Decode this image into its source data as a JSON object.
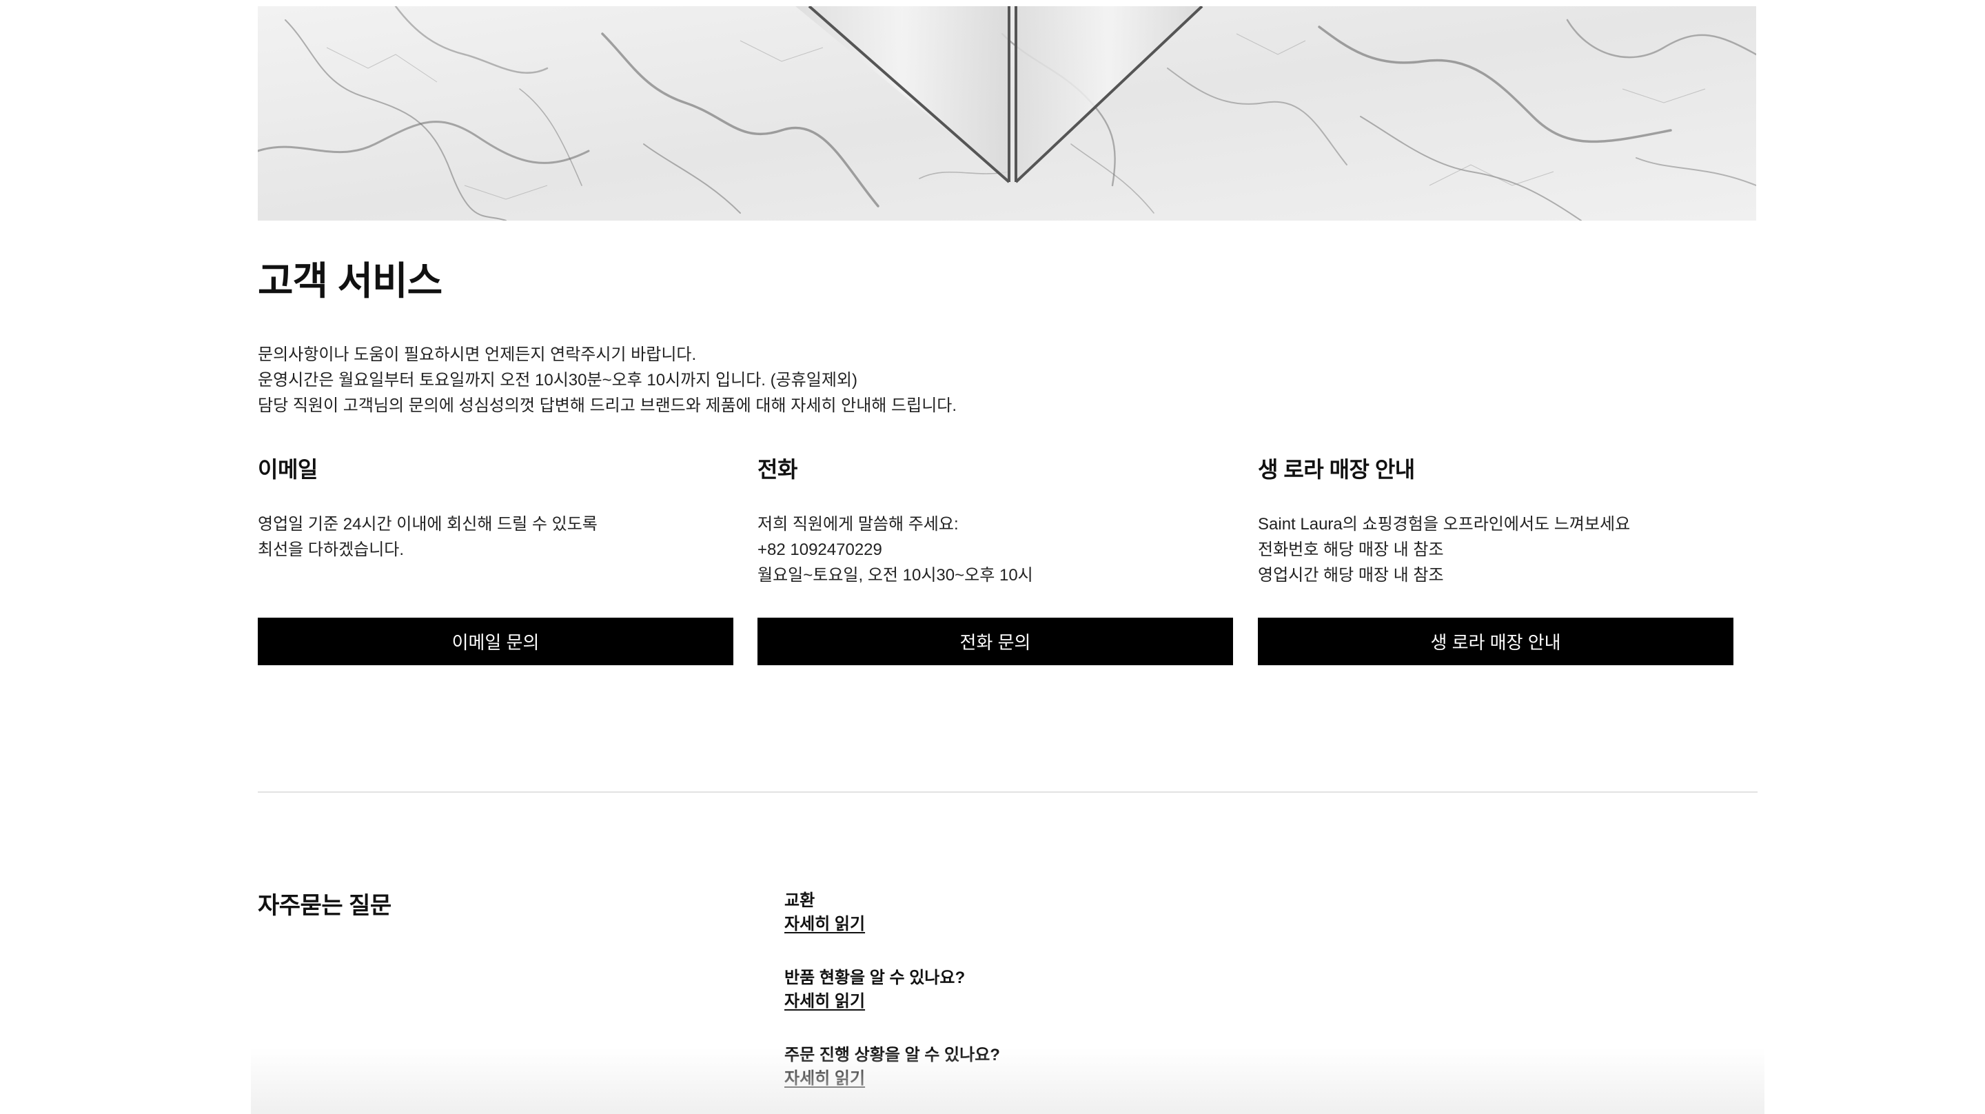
{
  "service": {
    "title": "고객 서비스",
    "intro": [
      "문의사항이나 도움이 필요하시면 언제든지 연락주시기 바랍니다.",
      "운영시간은 월요일부터 토요일까지 오전 10시30분~오후 10시까지 입니다. (공휴일제외)",
      "담당 직원이 고객님의 문의에 성심성의껏 답변해 드리고 브랜드와 제품에 대해 자세히 안내해 드립니다."
    ],
    "columns": [
      {
        "heading": "이메일",
        "lines": [
          "영업일 기준 24시간 이내에 회신해 드릴 수 있도록",
          "최선을 다하겠습니다."
        ],
        "button": "이메일 문의"
      },
      {
        "heading": "전화",
        "lines": [
          "저희 직원에게 말씀해 주세요:",
          "+82 1092470229",
          "월요일~토요일, 오전 10시30~오후 10시"
        ],
        "button": "전화 문의"
      },
      {
        "heading": "생 로라 매장 안내",
        "lines": [
          "Saint Laura의 쇼핑경험을 오프라인에서도 느껴보세요",
          "전화번호 해당 매장 내 참조",
          "영업시간 해당 매장 내 참조"
        ],
        "button": "생 로라 매장 안내"
      }
    ]
  },
  "faq": {
    "title": "자주묻는 질문",
    "items": [
      {
        "question": "교환",
        "link": "자세히 읽기"
      },
      {
        "question": "반품 현황을 알 수 있나요?",
        "link": "자세히 읽기"
      },
      {
        "question": "주문 진행 상황을 알 수 있나요?",
        "link": "자세히 읽기"
      }
    ]
  },
  "colors": {
    "button_bg": "#000000",
    "button_text": "#ffffff",
    "divider": "#e2e2e2"
  }
}
